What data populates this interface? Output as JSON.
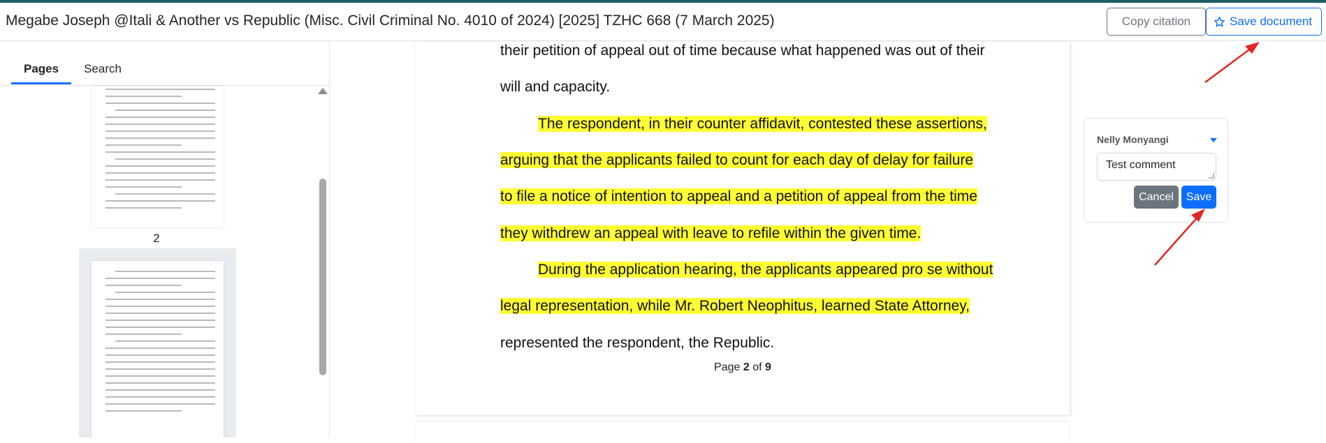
{
  "header": {
    "title": "Megabe Joseph @Itali & Another vs Republic (Misc. Civil Criminal No. 4010 of 2024) [2025] TZHC 668 (7 March 2025)",
    "copy_citation_label": "Copy citation",
    "save_document_label": "Save document",
    "save_icon": "star-outline-icon"
  },
  "sidebar": {
    "tabs": [
      {
        "label": "Pages",
        "active": true
      },
      {
        "label": "Search",
        "active": false
      }
    ],
    "thumbnail_page_number": "2"
  },
  "document": {
    "lines": [
      {
        "text": "their petition of appeal out of time because what happened was out of their",
        "highlighted": false
      },
      {
        "text": "will and capacity.",
        "highlighted": false
      },
      {
        "text": "The respondent, in their counter affidavit, contested these assertions,",
        "highlighted": true
      },
      {
        "text": "arguing that the applicants failed to count for each day of delay for failure",
        "highlighted": true
      },
      {
        "text": "to file a notice of intention to appeal and a petition of appeal from the time",
        "highlighted": true
      },
      {
        "text": "they withdrew an appeal with leave to refile within the given time.",
        "highlighted": true
      },
      {
        "text": "During the application hearing, the applicants appeared pro se without",
        "highlighted": true
      },
      {
        "text": "legal representation, while Mr. Robert Neophitus, learned State Attorney,",
        "highlighted": true
      },
      {
        "text": "represented the respondent, the Republic.",
        "highlighted": false
      }
    ],
    "page_label_prefix": "Page",
    "current_page": "2",
    "page_label_of": "of",
    "total_pages": "9"
  },
  "comment": {
    "user": "Nelly Monyangi",
    "text": "Test comment",
    "cancel_label": "Cancel",
    "save_label": "Save"
  },
  "colors": {
    "highlight": "#ffff33",
    "accent": "#0d6efd",
    "annotation_arrow": "#e32626"
  }
}
